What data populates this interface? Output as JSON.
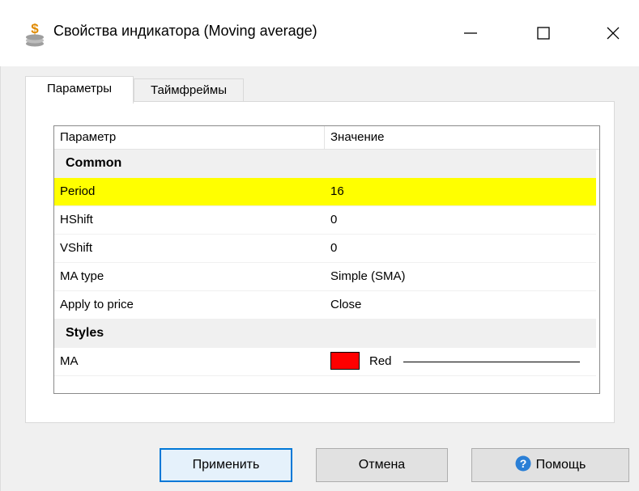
{
  "window": {
    "title": "Свойства индикатора (Moving average)",
    "icon": "app-money-stack-icon",
    "controls": [
      "minimize-icon",
      "maximize-icon",
      "close-icon"
    ]
  },
  "tabs": [
    {
      "label": "Параметры",
      "active": true
    },
    {
      "label": "Таймфреймы",
      "active": false
    }
  ],
  "table": {
    "headers": [
      "Параметр",
      "Значение"
    ],
    "rows": [
      {
        "type": "group",
        "name": "Common",
        "value": ""
      },
      {
        "type": "param",
        "name": "Period",
        "value": "16",
        "selected": true
      },
      {
        "type": "param",
        "name": "HShift",
        "value": "0"
      },
      {
        "type": "param",
        "name": "VShift",
        "value": "0"
      },
      {
        "type": "param",
        "name": "MA type",
        "value": "Simple (SMA)"
      },
      {
        "type": "param",
        "name": "Apply to price",
        "value": "Close"
      },
      {
        "type": "group",
        "name": "Styles",
        "value": ""
      },
      {
        "type": "param",
        "name": "MA",
        "value": "Red",
        "swatch_color": "#ff0000",
        "line_style": "solid"
      }
    ]
  },
  "buttons": {
    "apply": "Применить",
    "cancel": "Отмена",
    "help": "Помощь"
  },
  "colors": {
    "selection": "#ffff00",
    "accent": "#0078d7",
    "group_bg": "#f0f0f0"
  }
}
